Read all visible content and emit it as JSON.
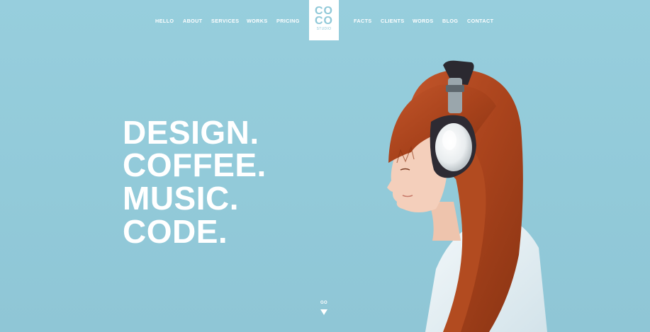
{
  "nav": {
    "left_items": [
      "HELLO",
      "ABOUT",
      "SERVICES",
      "WORKS",
      "PRICING"
    ],
    "right_items": [
      "FACTS",
      "CLIENTS",
      "WORDS",
      "BLOG",
      "CONTACT"
    ]
  },
  "logo": {
    "line1": "CO",
    "line2": "CO",
    "subtitle": "STUDIO"
  },
  "hero": {
    "lines": [
      "DESIGN.",
      "COFFEE.",
      "MUSIC.",
      "CODE."
    ]
  },
  "go": {
    "label": "GO",
    "icon": "triangle-down-icon"
  },
  "colors": {
    "background": "#93cbdb",
    "text": "#ffffff",
    "hair": "#b5491f",
    "shirt": "#e8f1f4"
  }
}
